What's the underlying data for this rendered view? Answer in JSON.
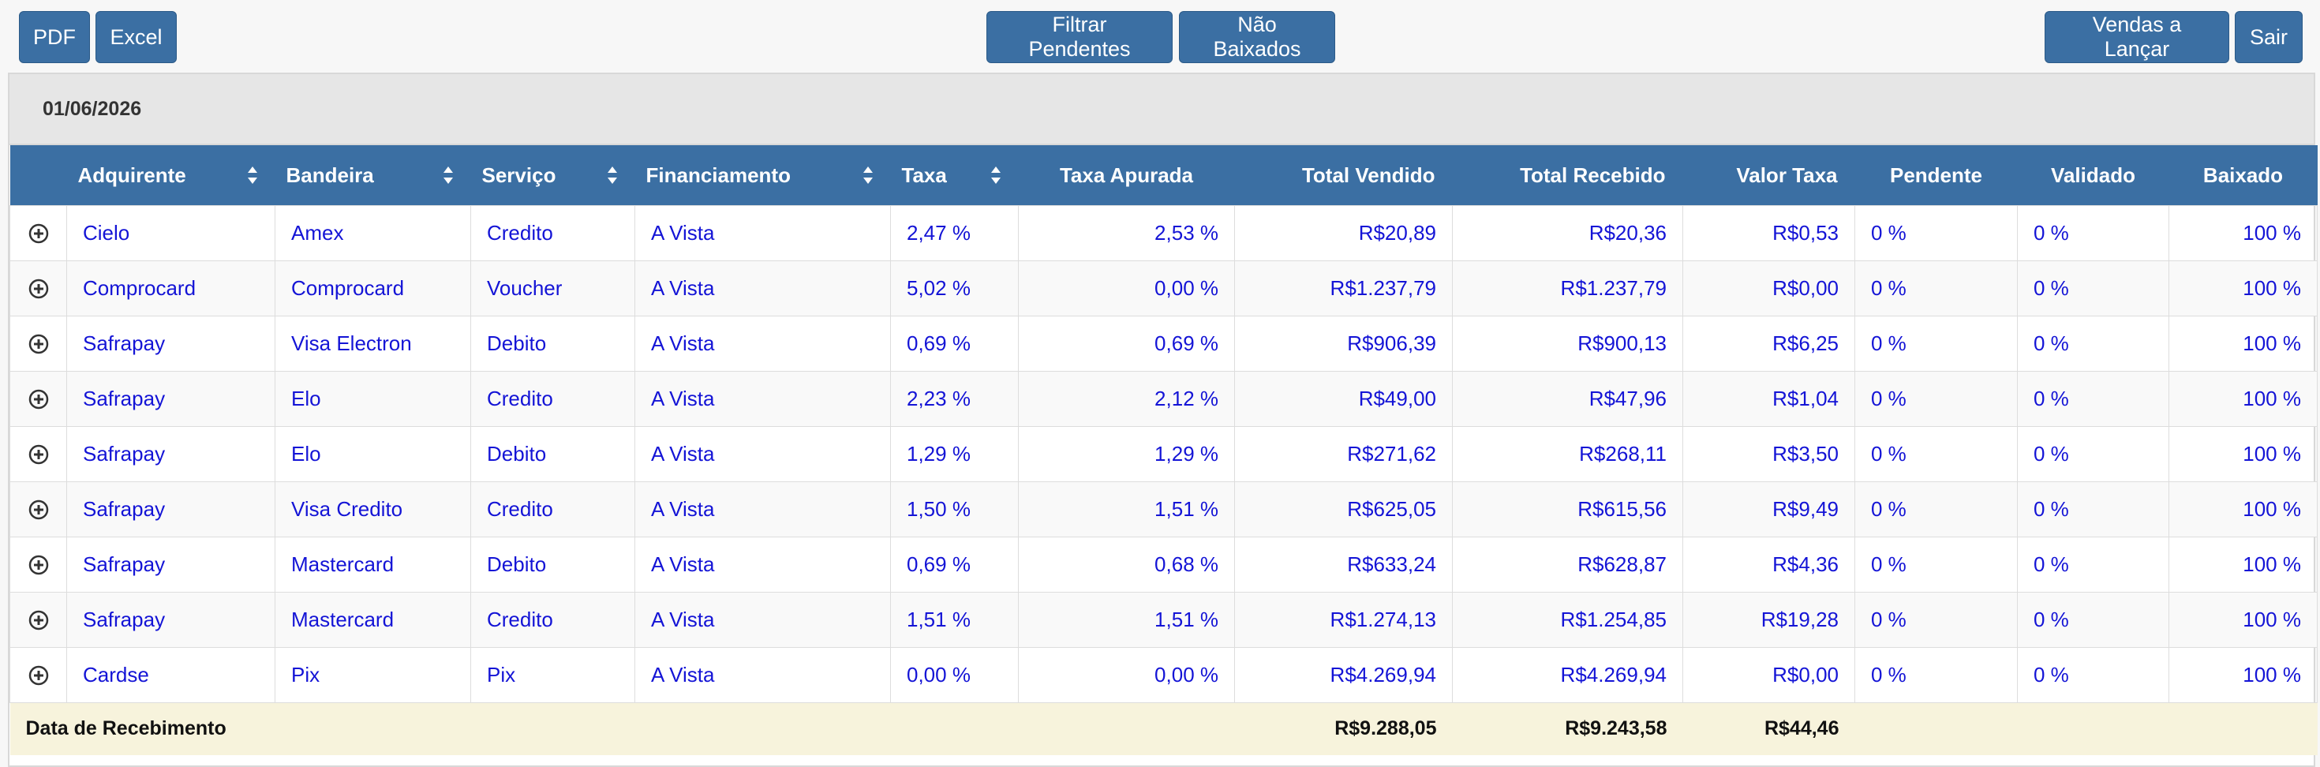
{
  "toolbar": {
    "pdf": "PDF",
    "excel": "Excel",
    "filtrar_pendentes": "Filtrar Pendentes",
    "nao_baixados": "Não Baixados",
    "vendas_a_lancar": "Vendas a Lançar",
    "sair": "Sair"
  },
  "date": "01/06/2026",
  "columns": {
    "adquirente": "Adquirente",
    "bandeira": "Bandeira",
    "servico": "Serviço",
    "financiamento": "Financiamento",
    "taxa": "Taxa",
    "taxa_apurada": "Taxa Apurada",
    "total_vendido": "Total Vendido",
    "total_recebido": "Total Recebido",
    "valor_taxa": "Valor Taxa",
    "pendente": "Pendente",
    "validado": "Validado",
    "baixado": "Baixado"
  },
  "rows": [
    {
      "adquirente": "Cielo",
      "bandeira": "Amex",
      "servico": "Credito",
      "financiamento": "A Vista",
      "taxa": "2,47 %",
      "taxa_apurada": "2,53 %",
      "total_vendido": "R$20,89",
      "total_recebido": "R$20,36",
      "valor_taxa": "R$0,53",
      "pendente": "0 %",
      "validado": "0 %",
      "baixado": "100 %"
    },
    {
      "adquirente": "Comprocard",
      "bandeira": "Comprocard",
      "servico": "Voucher",
      "financiamento": "A Vista",
      "taxa": "5,02 %",
      "taxa_apurada": "0,00 %",
      "total_vendido": "R$1.237,79",
      "total_recebido": "R$1.237,79",
      "valor_taxa": "R$0,00",
      "pendente": "0 %",
      "validado": "0 %",
      "baixado": "100 %"
    },
    {
      "adquirente": "Safrapay",
      "bandeira": "Visa Electron",
      "servico": "Debito",
      "financiamento": "A Vista",
      "taxa": "0,69 %",
      "taxa_apurada": "0,69 %",
      "total_vendido": "R$906,39",
      "total_recebido": "R$900,13",
      "valor_taxa": "R$6,25",
      "pendente": "0 %",
      "validado": "0 %",
      "baixado": "100 %"
    },
    {
      "adquirente": "Safrapay",
      "bandeira": "Elo",
      "servico": "Credito",
      "financiamento": "A Vista",
      "taxa": "2,23 %",
      "taxa_apurada": "2,12 %",
      "total_vendido": "R$49,00",
      "total_recebido": "R$47,96",
      "valor_taxa": "R$1,04",
      "pendente": "0 %",
      "validado": "0 %",
      "baixado": "100 %"
    },
    {
      "adquirente": "Safrapay",
      "bandeira": "Elo",
      "servico": "Debito",
      "financiamento": "A Vista",
      "taxa": "1,29 %",
      "taxa_apurada": "1,29 %",
      "total_vendido": "R$271,62",
      "total_recebido": "R$268,11",
      "valor_taxa": "R$3,50",
      "pendente": "0 %",
      "validado": "0 %",
      "baixado": "100 %"
    },
    {
      "adquirente": "Safrapay",
      "bandeira": "Visa Credito",
      "servico": "Credito",
      "financiamento": "A Vista",
      "taxa": "1,50 %",
      "taxa_apurada": "1,51 %",
      "total_vendido": "R$625,05",
      "total_recebido": "R$615,56",
      "valor_taxa": "R$9,49",
      "pendente": "0 %",
      "validado": "0 %",
      "baixado": "100 %"
    },
    {
      "adquirente": "Safrapay",
      "bandeira": "Mastercard",
      "servico": "Debito",
      "financiamento": "A Vista",
      "taxa": "0,69 %",
      "taxa_apurada": "0,68 %",
      "total_vendido": "R$633,24",
      "total_recebido": "R$628,87",
      "valor_taxa": "R$4,36",
      "pendente": "0 %",
      "validado": "0 %",
      "baixado": "100 %"
    },
    {
      "adquirente": "Safrapay",
      "bandeira": "Mastercard",
      "servico": "Credito",
      "financiamento": "A Vista",
      "taxa": "1,51 %",
      "taxa_apurada": "1,51 %",
      "total_vendido": "R$1.274,13",
      "total_recebido": "R$1.254,85",
      "valor_taxa": "R$19,28",
      "pendente": "0 %",
      "validado": "0 %",
      "baixado": "100 %"
    },
    {
      "adquirente": "Cardse",
      "bandeira": "Pix",
      "servico": "Pix",
      "financiamento": "A Vista",
      "taxa": "0,00 %",
      "taxa_apurada": "0,00 %",
      "total_vendido": "R$4.269,94",
      "total_recebido": "R$4.269,94",
      "valor_taxa": "R$0,00",
      "pendente": "0 %",
      "validado": "0 %",
      "baixado": "100 %"
    }
  ],
  "footer": {
    "label": "Data de Recebimento",
    "total_vendido": "R$9.288,05",
    "total_recebido": "R$9.243,58",
    "valor_taxa": "R$44,46"
  },
  "colors": {
    "header_bg": "#3b6fa3",
    "link_text": "#1414d6",
    "footer_bg": "#f7f3dc"
  }
}
